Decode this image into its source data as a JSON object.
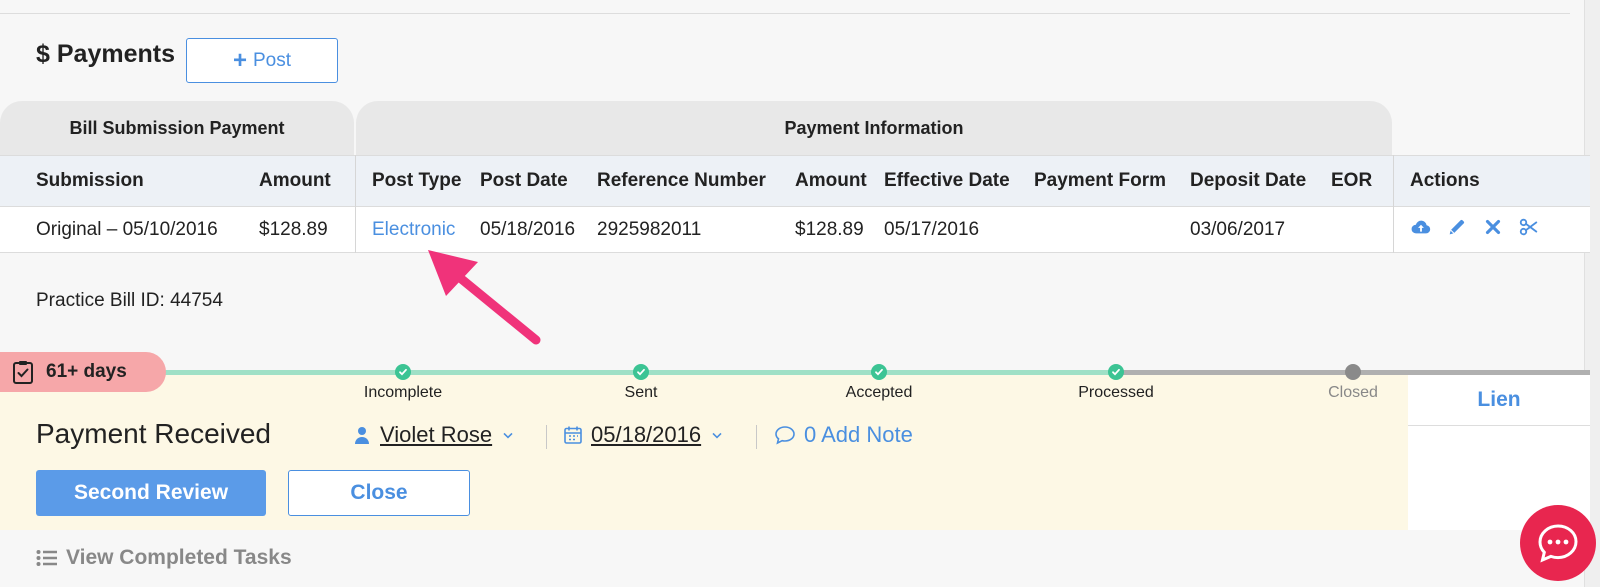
{
  "header": {
    "currency_icon": "dollar-sign",
    "title": "Payments",
    "post_button": "Post"
  },
  "table": {
    "groups": {
      "bill_submission": "Bill Submission Payment",
      "payment_information": "Payment Information"
    },
    "columns": {
      "submission": "Submission",
      "amount": "Amount",
      "post_type": "Post Type",
      "post_date": "Post Date",
      "reference_number": "Reference Number",
      "amount2": "Amount",
      "effective_date": "Effective Date",
      "payment_form": "Payment Form",
      "deposit_date": "Deposit Date",
      "eor": "EOR",
      "actions": "Actions"
    },
    "rows": [
      {
        "submission": "Original – 05/10/2016",
        "amount": "$128.89",
        "post_type": "Electronic",
        "post_date": "05/18/2016",
        "reference_number": "2925982011",
        "amount2": "$128.89",
        "effective_date": "05/17/2016",
        "payment_form": "",
        "deposit_date": "03/06/2017",
        "eor": ""
      }
    ],
    "action_icons": [
      "cloud-upload-icon",
      "pencil-icon",
      "x-icon",
      "scissors-icon"
    ]
  },
  "bill_id": "Practice Bill ID: 44754",
  "status": {
    "days_badge": "61+ days",
    "steps": [
      {
        "label": "Incomplete",
        "state": "done"
      },
      {
        "label": "Sent",
        "state": "done"
      },
      {
        "label": "Accepted",
        "state": "done"
      },
      {
        "label": "Processed",
        "state": "done"
      },
      {
        "label": "Closed",
        "state": "pending"
      }
    ],
    "title": "Payment Received",
    "assignee": "Violet Rose",
    "date": "05/18/2016",
    "note": "0 Add Note",
    "buttons": {
      "second_review": "Second Review",
      "close": "Close"
    },
    "side_tab": "Lien"
  },
  "completed_tasks": "View Completed Tasks",
  "colors": {
    "accent": "#4a8fe0",
    "success": "#3cc494",
    "alert": "#f6a7a9",
    "chat": "#e8264f"
  }
}
